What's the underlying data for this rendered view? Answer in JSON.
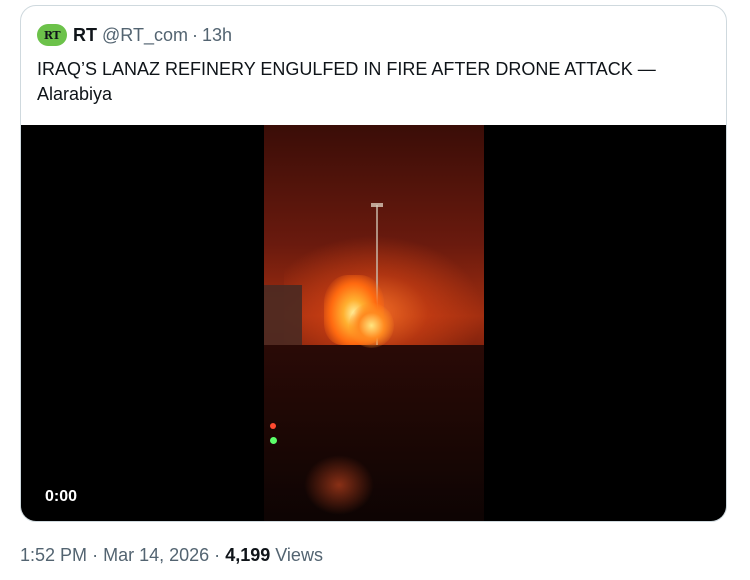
{
  "tweet": {
    "avatar_text": "RT",
    "author_name": "RT",
    "author_handle": "@RT_com",
    "separator": "·",
    "time_ago": "13h",
    "text": "IRAQ’S LANAZ REFINERY ENGULFED IN FIRE AFTER DRONE ATTACK — Alarabiya"
  },
  "video": {
    "time": "0:00",
    "description_icon": "video-player"
  },
  "meta": {
    "time": "1:52 PM",
    "separator": "·",
    "date": "Mar 14, 2026",
    "views_count": "4,199",
    "views_label": "Views"
  },
  "colors": {
    "avatar_bg": "#6cc24a",
    "secondary_text": "#536471",
    "border": "#cfd9de"
  }
}
